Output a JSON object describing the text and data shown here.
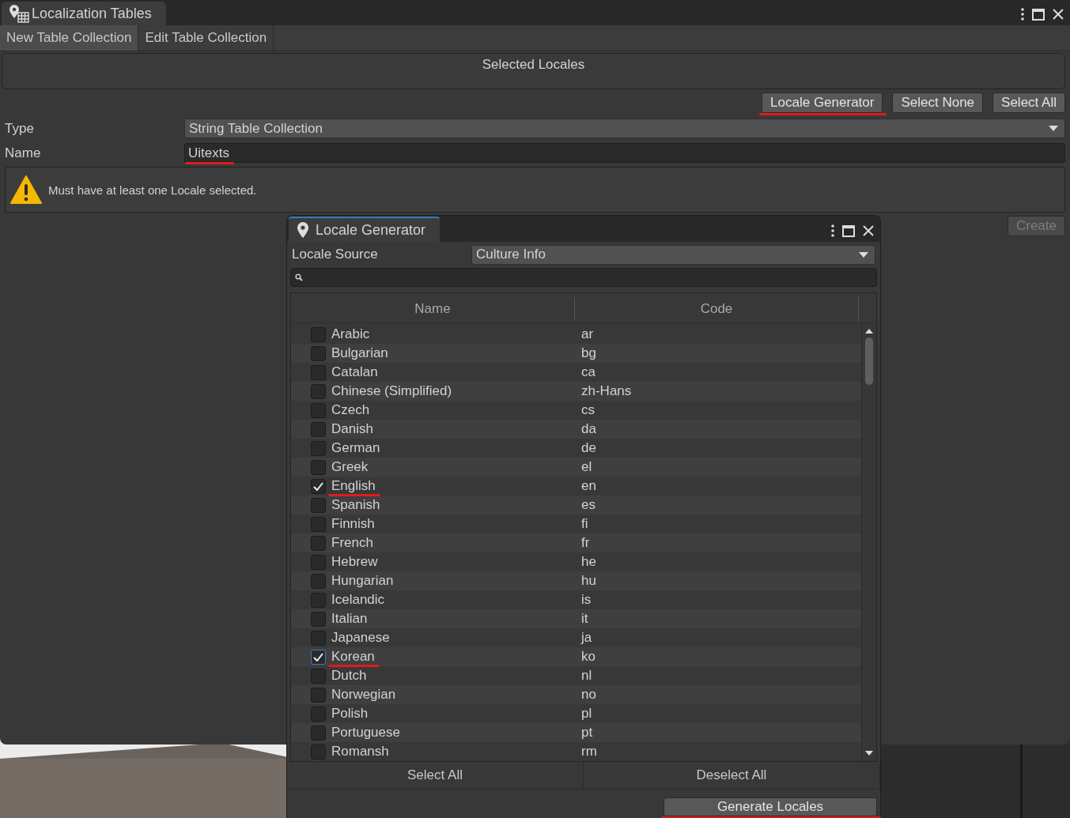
{
  "main_window": {
    "title": "Localization Tables",
    "tabs": [
      {
        "label": "New Table Collection",
        "selected": true
      },
      {
        "label": "Edit Table Collection",
        "selected": false
      }
    ],
    "selected_locales": {
      "title": "Selected Locales"
    },
    "buttons": [
      {
        "label": "Locale Generator",
        "underlined": true
      },
      {
        "label": "Select None"
      },
      {
        "label": "Select All"
      }
    ],
    "fields": [
      {
        "kind": "dropdown",
        "label": "Type",
        "value": "String Table Collection"
      },
      {
        "kind": "text",
        "label": "Name",
        "value": "Uitexts",
        "underlined": true
      }
    ],
    "warning": "Must have at least one Locale selected.",
    "create_button": {
      "label": "Create",
      "disabled": true
    }
  },
  "locale_generator": {
    "title": "Locale Generator",
    "source_label": "Locale Source",
    "source_value": "Culture Info",
    "columns": [
      "Name",
      "Code"
    ],
    "rows": [
      {
        "name": "Arabic",
        "code": "ar",
        "checked": false
      },
      {
        "name": "Bulgarian",
        "code": "bg",
        "checked": false
      },
      {
        "name": "Catalan",
        "code": "ca",
        "checked": false
      },
      {
        "name": "Chinese (Simplified)",
        "code": "zh-Hans",
        "checked": false
      },
      {
        "name": "Czech",
        "code": "cs",
        "checked": false
      },
      {
        "name": "Danish",
        "code": "da",
        "checked": false
      },
      {
        "name": "German",
        "code": "de",
        "checked": false
      },
      {
        "name": "Greek",
        "code": "el",
        "checked": false
      },
      {
        "name": "English",
        "code": "en",
        "checked": true,
        "underlined": true
      },
      {
        "name": "Spanish",
        "code": "es",
        "checked": false
      },
      {
        "name": "Finnish",
        "code": "fi",
        "checked": false
      },
      {
        "name": "French",
        "code": "fr",
        "checked": false
      },
      {
        "name": "Hebrew",
        "code": "he",
        "checked": false
      },
      {
        "name": "Hungarian",
        "code": "hu",
        "checked": false
      },
      {
        "name": "Icelandic",
        "code": "is",
        "checked": false
      },
      {
        "name": "Italian",
        "code": "it",
        "checked": false
      },
      {
        "name": "Japanese",
        "code": "ja",
        "checked": false
      },
      {
        "name": "Korean",
        "code": "ko",
        "checked": true,
        "focused": true,
        "underlined": true
      },
      {
        "name": "Dutch",
        "code": "nl",
        "checked": false
      },
      {
        "name": "Norwegian",
        "code": "no",
        "checked": false
      },
      {
        "name": "Polish",
        "code": "pl",
        "checked": false
      },
      {
        "name": "Portuguese",
        "code": "pt",
        "checked": false
      },
      {
        "name": "Romansh",
        "code": "rm",
        "checked": false
      }
    ],
    "footer_buttons": [
      "Select All",
      "Deselect All"
    ],
    "generate_button": {
      "label": "Generate Locales",
      "underlined": true
    }
  }
}
